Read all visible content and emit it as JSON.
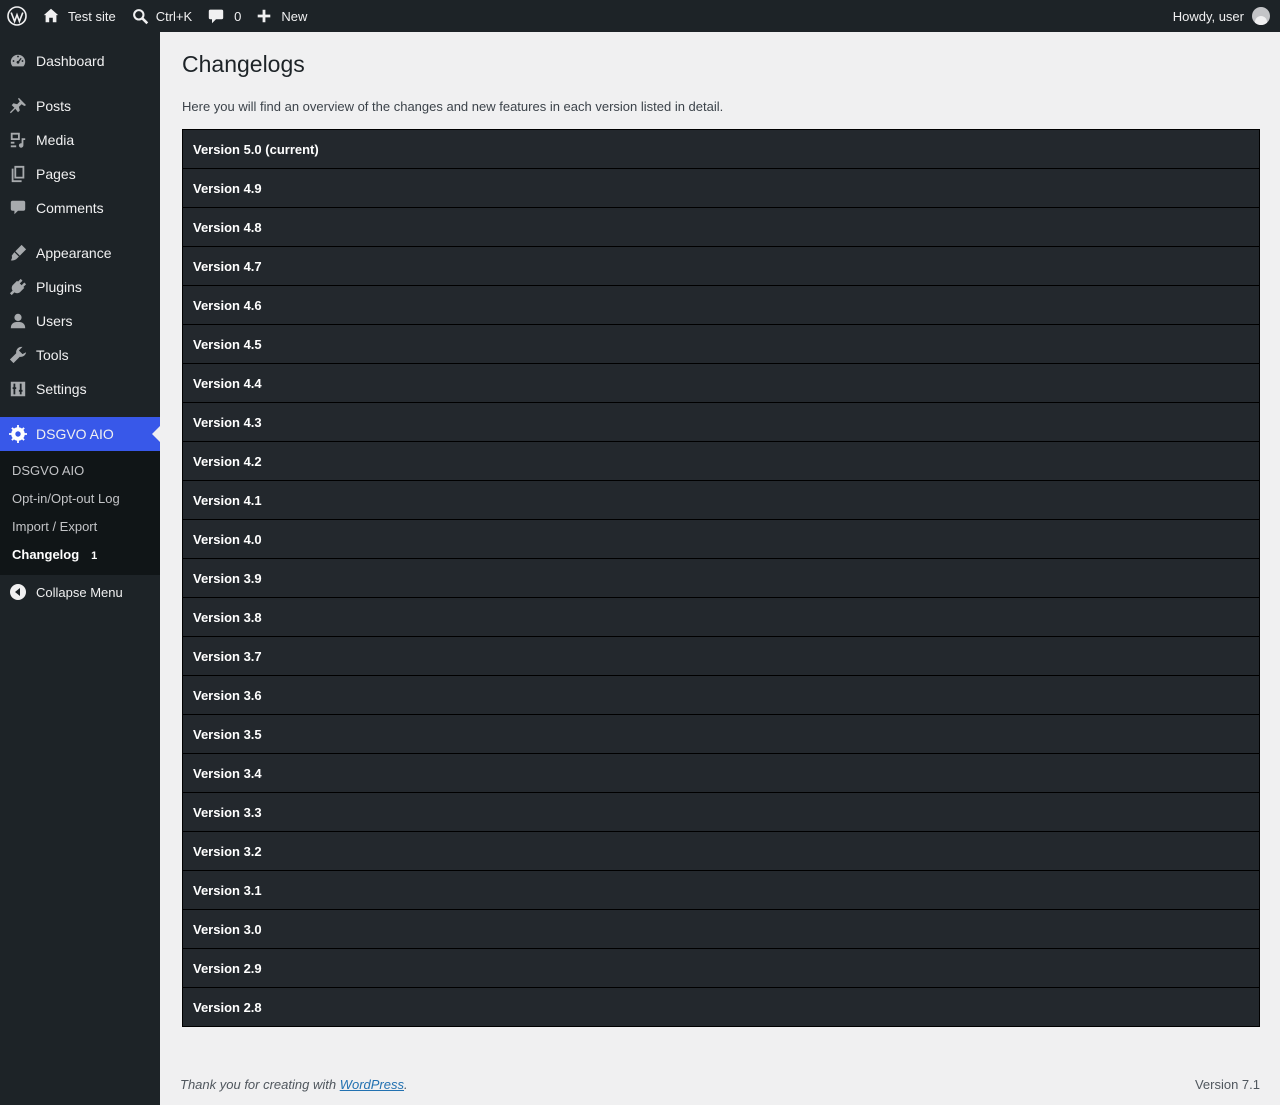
{
  "adminbar": {
    "site_name": "Test site",
    "search_shortcut": "Ctrl+K",
    "comments_count": "0",
    "new_label": "New",
    "howdy": "Howdy, user"
  },
  "sidebar": {
    "items": [
      {
        "label": "Dashboard",
        "icon": "dashboard-icon"
      },
      {
        "label": "Posts",
        "icon": "pin-icon"
      },
      {
        "label": "Media",
        "icon": "media-icon"
      },
      {
        "label": "Pages",
        "icon": "pages-icon"
      },
      {
        "label": "Comments",
        "icon": "comment-icon"
      },
      {
        "label": "Appearance",
        "icon": "brush-icon"
      },
      {
        "label": "Plugins",
        "icon": "plug-icon"
      },
      {
        "label": "Users",
        "icon": "user-icon"
      },
      {
        "label": "Tools",
        "icon": "wrench-icon"
      },
      {
        "label": "Settings",
        "icon": "settings-icon"
      },
      {
        "label": "DSGVO AIO",
        "icon": "gear-icon"
      }
    ],
    "submenu": [
      {
        "label": "DSGVO AIO"
      },
      {
        "label": "Opt-in/Opt-out Log"
      },
      {
        "label": "Import / Export"
      },
      {
        "label": "Changelog",
        "badge": "1"
      }
    ],
    "collapse_label": "Collapse Menu"
  },
  "main": {
    "title": "Changelogs",
    "intro": "Here you will find an overview of the changes and new features in each version listed in detail.",
    "versions": [
      "Version 5.0 (current)",
      "Version 4.9",
      "Version 4.8",
      "Version 4.7",
      "Version 4.6",
      "Version 4.5",
      "Version 4.4",
      "Version 4.3",
      "Version 4.2",
      "Version 4.1",
      "Version 4.0",
      "Version 3.9",
      "Version 3.8",
      "Version 3.7",
      "Version 3.6",
      "Version 3.5",
      "Version 3.4",
      "Version 3.3",
      "Version 3.2",
      "Version 3.1",
      "Version 3.0",
      "Version 2.9",
      "Version 2.8"
    ]
  },
  "footer": {
    "thanks_prefix": "Thank you for creating with ",
    "thanks_link": "WordPress",
    "thanks_suffix": ".",
    "version": "Version 7.1"
  }
}
